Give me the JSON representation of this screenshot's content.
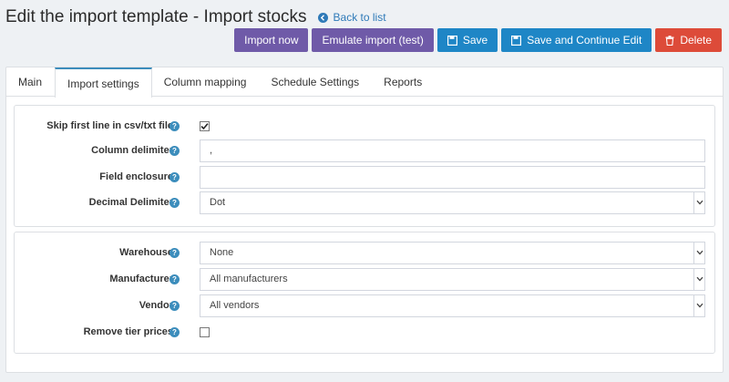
{
  "header": {
    "title": "Edit the import template - Import stocks",
    "back_label": "Back to list"
  },
  "actions": {
    "import_now": "Import now",
    "emulate_import": "Emulate import (test)",
    "save": "Save",
    "save_continue": "Save and Continue Edit",
    "delete": "Delete"
  },
  "tabs": [
    {
      "label": "Main"
    },
    {
      "label": "Import settings"
    },
    {
      "label": "Column mapping"
    },
    {
      "label": "Schedule Settings"
    },
    {
      "label": "Reports"
    }
  ],
  "settings": {
    "skip_first_line": {
      "label": "Skip first line in csv/txt file",
      "checked": true
    },
    "column_delimiter": {
      "label": "Column delimiter",
      "value": ","
    },
    "field_enclosure": {
      "label": "Field enclosure",
      "value": ""
    },
    "decimal_delimiter": {
      "label": "Decimal Delimiter",
      "value": "Dot"
    }
  },
  "filters": {
    "warehouse": {
      "label": "Warehouse",
      "value": "None"
    },
    "manufacturer": {
      "label": "Manufacturer",
      "value": "All manufacturers"
    },
    "vendor": {
      "label": "Vendor",
      "value": "All vendors"
    },
    "remove_tier_prices": {
      "label": "Remove tier prices",
      "checked": false
    }
  },
  "colors": {
    "purple": "#6f5aa8",
    "blue": "#1e86c6",
    "red": "#dd4b39",
    "help": "#3c8dbc"
  }
}
